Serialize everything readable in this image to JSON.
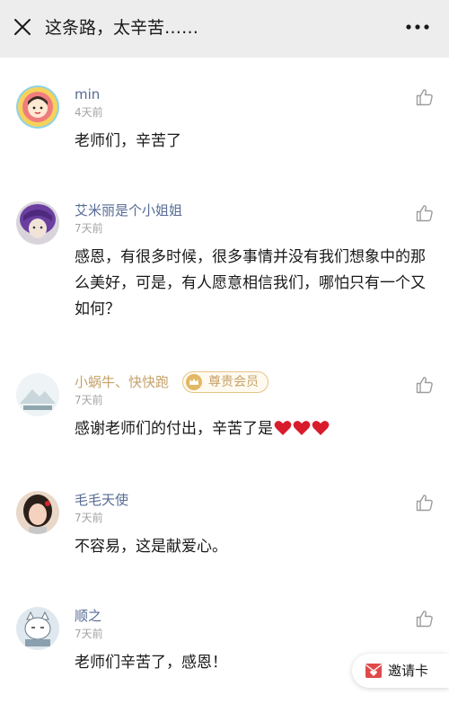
{
  "header": {
    "title": "这条路，太辛苦……"
  },
  "comments": [
    {
      "name": "min",
      "time": "4天前",
      "text": "老师们，辛苦了"
    },
    {
      "name": "艾米丽是个小姐姐",
      "time": "7天前",
      "text": "感恩，有很多时候，很多事情并没有我们想象中的那么美好，可是，有人愿意相信我们，哪怕只有一个又如何？"
    },
    {
      "name": "小蜗牛、快快跑",
      "badge": "尊贵会员",
      "time": "7天前",
      "text": "感谢老师们的付出，辛苦了是",
      "hearts": 3
    },
    {
      "name": "毛毛天使",
      "time": "7天前",
      "text": "不容易，这是献爱心。"
    },
    {
      "name": "顺之",
      "time": "7天前",
      "text": "老师们辛苦了，感恩！"
    }
  ],
  "invite": {
    "label": "邀请卡"
  },
  "colors": {
    "name": "#576b95",
    "vip": "#c7a36a",
    "heart": "#d91c2b",
    "invite_icon": "#e04a4a"
  },
  "icons": {
    "close": "close-icon",
    "more": "more-icon",
    "like": "thumbs-up-icon",
    "invite": "envelope-icon"
  }
}
